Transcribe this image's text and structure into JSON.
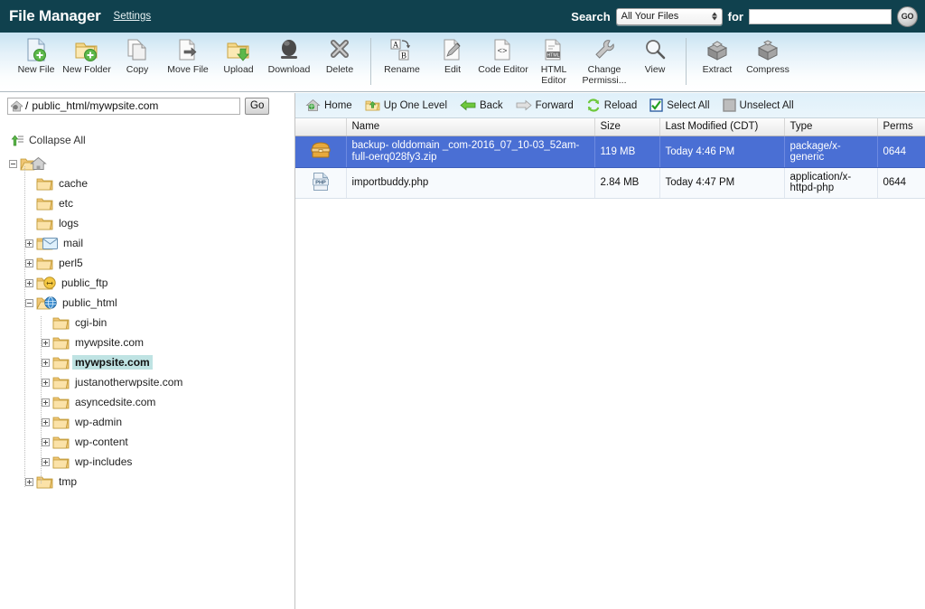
{
  "header": {
    "title": "File Manager",
    "settings_label": "Settings",
    "search_label": "Search",
    "search_scope": "All Your Files",
    "for_label": "for",
    "search_value": "",
    "search_placeholder": "",
    "go_label": "GO"
  },
  "toolbar": {
    "items": [
      {
        "label": "New File",
        "icon": "new-file-icon"
      },
      {
        "label": "New Folder",
        "icon": "new-folder-icon"
      },
      {
        "label": "Copy",
        "icon": "copy-icon"
      },
      {
        "label": "Move File",
        "icon": "move-file-icon"
      },
      {
        "label": "Upload",
        "icon": "upload-icon"
      },
      {
        "label": "Download",
        "icon": "download-icon"
      },
      {
        "label": "Delete",
        "icon": "delete-icon"
      },
      {
        "label": "Rename",
        "icon": "rename-icon"
      },
      {
        "label": "Edit",
        "icon": "edit-icon"
      },
      {
        "label": "Code Editor",
        "icon": "code-editor-icon"
      },
      {
        "label": "HTML Editor",
        "icon": "html-editor-icon"
      },
      {
        "label": "Change Permissi...",
        "icon": "change-permissions-icon"
      },
      {
        "label": "View",
        "icon": "view-icon"
      },
      {
        "label": "Extract",
        "icon": "extract-icon"
      },
      {
        "label": "Compress",
        "icon": "compress-icon"
      }
    ]
  },
  "pathbar": {
    "slash": "/",
    "value": "public_html/mywpsite.com",
    "go_label": "Go"
  },
  "tree": {
    "collapse_all_label": "Collapse All",
    "nodes": [
      {
        "label": "",
        "depth": 0,
        "expander": "minus",
        "icon": "home-folder-icon",
        "selected": false
      },
      {
        "label": "cache",
        "depth": 1,
        "expander": "none",
        "icon": "folder-icon",
        "selected": false
      },
      {
        "label": "etc",
        "depth": 1,
        "expander": "none",
        "icon": "folder-icon",
        "selected": false
      },
      {
        "label": "logs",
        "depth": 1,
        "expander": "none",
        "icon": "folder-icon",
        "selected": false
      },
      {
        "label": "mail",
        "depth": 1,
        "expander": "plus",
        "icon": "mail-folder-icon",
        "selected": false
      },
      {
        "label": "perl5",
        "depth": 1,
        "expander": "plus",
        "icon": "folder-icon",
        "selected": false
      },
      {
        "label": "public_ftp",
        "depth": 1,
        "expander": "plus",
        "icon": "ftp-folder-icon",
        "selected": false
      },
      {
        "label": "public_html",
        "depth": 1,
        "expander": "minus",
        "icon": "web-folder-icon",
        "selected": false
      },
      {
        "label": "cgi-bin",
        "depth": 2,
        "expander": "none",
        "icon": "folder-icon",
        "selected": false
      },
      {
        "label": "mywpsite.com",
        "depth": 2,
        "expander": "plus",
        "icon": "folder-icon",
        "selected": false
      },
      {
        "label": "mywpsite.com",
        "depth": 2,
        "expander": "plus",
        "icon": "folder-icon",
        "selected": true
      },
      {
        "label": "justanotherwpsite.com",
        "depth": 2,
        "expander": "plus",
        "icon": "folder-icon",
        "selected": false
      },
      {
        "label": "asyncedsite.com",
        "depth": 2,
        "expander": "plus",
        "icon": "folder-icon",
        "selected": false
      },
      {
        "label": "wp-admin",
        "depth": 2,
        "expander": "plus",
        "icon": "folder-icon",
        "selected": false
      },
      {
        "label": "wp-content",
        "depth": 2,
        "expander": "plus",
        "icon": "folder-icon",
        "selected": false
      },
      {
        "label": "wp-includes",
        "depth": 2,
        "expander": "plus",
        "icon": "folder-icon",
        "selected": false
      },
      {
        "label": "tmp",
        "depth": 1,
        "expander": "plus",
        "icon": "folder-icon",
        "selected": false
      }
    ]
  },
  "filepanel": {
    "nav": [
      {
        "label": "Home",
        "icon": "home-icon"
      },
      {
        "label": "Up One Level",
        "icon": "up-one-level-icon"
      },
      {
        "label": "Back",
        "icon": "back-arrow-icon"
      },
      {
        "label": "Forward",
        "icon": "forward-arrow-icon"
      },
      {
        "label": "Reload",
        "icon": "reload-icon"
      },
      {
        "label": "Select All",
        "icon": "checked-checkbox-icon"
      },
      {
        "label": "Unselect All",
        "icon": "unchecked-checkbox-icon"
      }
    ],
    "columns": [
      "",
      "Name",
      "Size",
      "Last Modified (CDT)",
      "Type",
      "Perms"
    ],
    "rows": [
      {
        "icon": "zip-archive-icon",
        "name": "backup- olddomain _com-2016_07_10-03_52am-full-oerq028fy3.zip",
        "size": "119 MB",
        "modified": "Today 4:46 PM",
        "type": "package/x-generic",
        "perms": "0644",
        "selected": true
      },
      {
        "icon": "php-file-icon",
        "name": "importbuddy.php",
        "size": "2.84 MB",
        "modified": "Today 4:47 PM",
        "type": "application/x-httpd-php",
        "perms": "0644",
        "selected": false
      }
    ]
  },
  "colors": {
    "header_bg": "#10414e",
    "toolbar_top": "#c8e3f2",
    "row_selected": "#4a6fd4",
    "tree_selected": "#bfe3e3",
    "folder_yellow": "#f0c675"
  }
}
